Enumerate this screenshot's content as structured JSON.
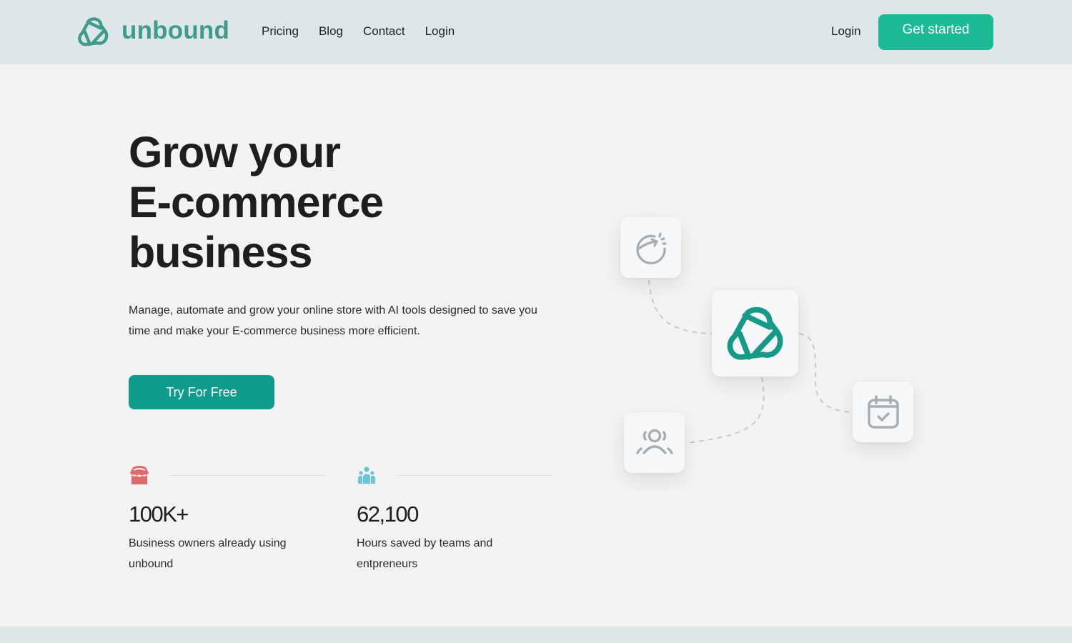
{
  "brand": {
    "name": "unbound",
    "color": "#3f9c8a"
  },
  "nav": {
    "links": [
      {
        "label": "Pricing"
      },
      {
        "label": "Blog"
      },
      {
        "label": "Contact"
      },
      {
        "label": "Login"
      }
    ],
    "login_label": "Login",
    "cta_label": "Get started",
    "cta_color": "#1bbc95"
  },
  "hero": {
    "title_lines": [
      "Grow your",
      "E-commerce",
      "business"
    ],
    "description": "Manage, automate and grow your online store with AI tools designed to save you time and make your E-commerce business more efficient.",
    "cta_label": "Try For Free",
    "cta_color": "#0f9c8c"
  },
  "stats": [
    {
      "icon": "storefront-icon",
      "icon_color": "#e06a6a",
      "value": "100K+",
      "label": "Business owners already using unbound"
    },
    {
      "icon": "team-icon",
      "icon_color": "#6cc4d4",
      "value": "62,100",
      "label": "Hours saved by teams and entpreneurs"
    }
  ],
  "illustration": {
    "cards": [
      {
        "icon": "growth-chart-icon"
      },
      {
        "icon": "unbound-logo-icon"
      },
      {
        "icon": "people-group-icon"
      },
      {
        "icon": "calendar-check-icon"
      }
    ]
  }
}
